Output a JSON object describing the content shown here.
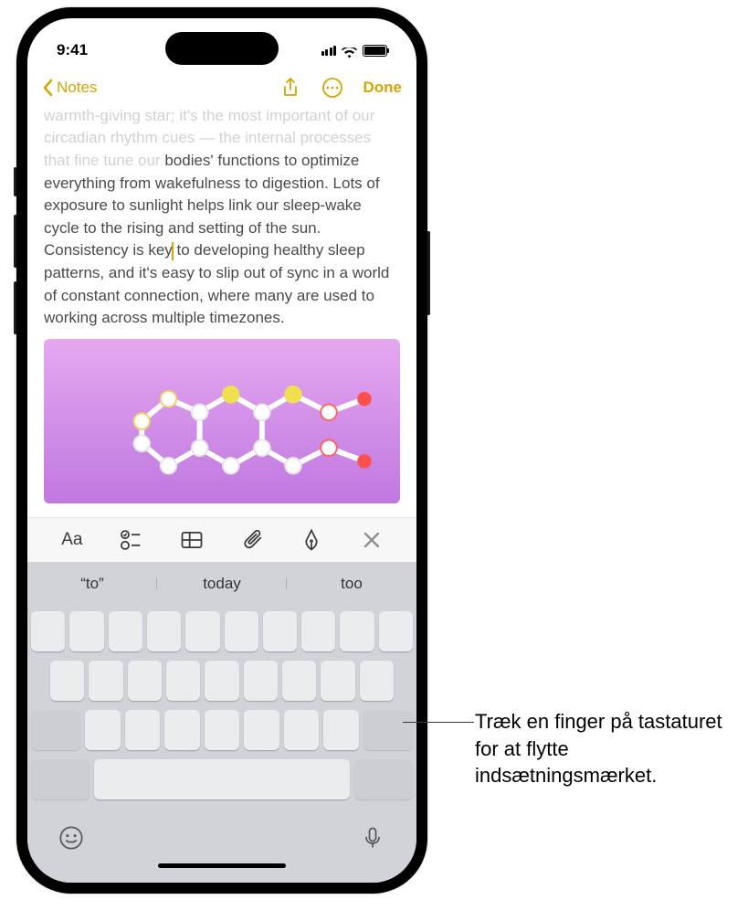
{
  "status": {
    "time": "9:41"
  },
  "nav": {
    "back_label": "Notes",
    "done_label": "Done"
  },
  "note": {
    "faded_before": "sunlight has grown. The sun is more than just a warmth-giving star; it's the most important of our circadian rhythm cues — the internal processes that fine tune our",
    "body_before_cursor": "bodies' functions to optimize everything from wakefulness to digestion. Lots of exposure to sunlight helps link our sleep-wake cycle to the rising and setting of the sun. Consistency is key",
    "body_after_cursor": "to developing healthy sleep patterns, and it's easy to slip out of sync in a world of constant connection, where many are used to working across multiple timezones."
  },
  "suggestions": [
    "“to”",
    "today",
    "too"
  ],
  "callout": {
    "text": "Træk en finger på tastaturet for at flytte indsætningsmærket."
  },
  "format_icons": {
    "text_format": "Aa"
  }
}
